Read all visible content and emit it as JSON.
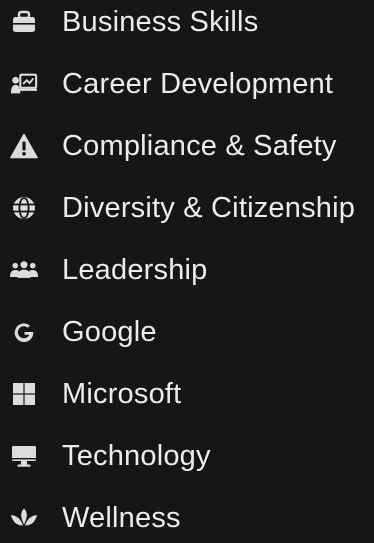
{
  "menu": {
    "items": [
      {
        "label": "Business Skills",
        "icon": "briefcase-icon"
      },
      {
        "label": "Career Development",
        "icon": "presentation-icon"
      },
      {
        "label": "Compliance & Safety",
        "icon": "warning-icon"
      },
      {
        "label": "Diversity & Citizenship",
        "icon": "globe-icon"
      },
      {
        "label": "Leadership",
        "icon": "users-icon"
      },
      {
        "label": "Google",
        "icon": "google-icon"
      },
      {
        "label": "Microsoft",
        "icon": "microsoft-icon"
      },
      {
        "label": "Technology",
        "icon": "desktop-icon"
      },
      {
        "label": "Wellness",
        "icon": "lotus-icon"
      }
    ]
  },
  "colors": {
    "background": "#161616",
    "text": "#ececec",
    "icon": "#dcdcdc"
  }
}
